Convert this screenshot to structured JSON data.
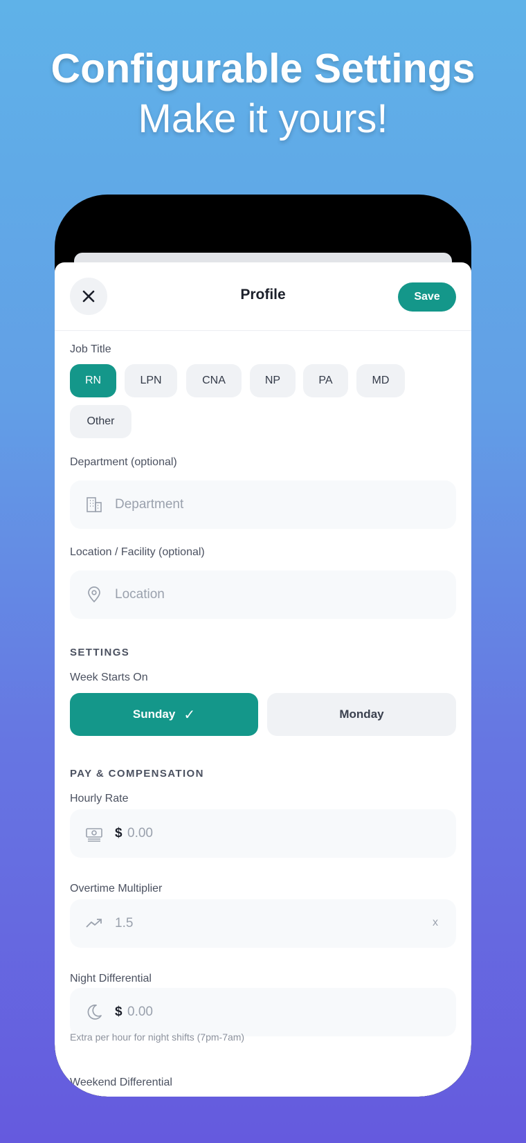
{
  "promo": {
    "headline": "Configurable Settings",
    "subheadline": "Make it yours!"
  },
  "header": {
    "title": "Profile",
    "save_label": "Save",
    "close_icon": "close-icon"
  },
  "job_title": {
    "label": "Job Title",
    "options": [
      "RN",
      "LPN",
      "CNA",
      "NP",
      "PA",
      "MD",
      "Other"
    ],
    "selected": "RN"
  },
  "department": {
    "label": "Department (optional)",
    "placeholder": "Department",
    "icon": "building-icon"
  },
  "location": {
    "label": "Location / Facility (optional)",
    "placeholder": "Location",
    "icon": "map-pin-icon"
  },
  "settings": {
    "section_title": "SETTINGS",
    "week_starts_label": "Week Starts On",
    "options": [
      "Sunday",
      "Monday"
    ],
    "selected": "Sunday",
    "check_mark": "✓"
  },
  "pay": {
    "section_title": "PAY & COMPENSATION",
    "hourly_rate": {
      "label": "Hourly Rate",
      "currency": "$",
      "placeholder": "0.00",
      "icon": "money-icon"
    },
    "overtime": {
      "label": "Overtime Multiplier",
      "placeholder": "1.5",
      "suffix": "x",
      "icon": "trending-up-icon"
    },
    "night_diff": {
      "label": "Night Differential",
      "currency": "$",
      "placeholder": "0.00",
      "icon": "moon-icon",
      "helper": "Extra per hour for night shifts (7pm-7am)"
    },
    "weekend_diff": {
      "label": "Weekend Differential"
    }
  },
  "colors": {
    "accent": "#14978a",
    "chip_bg": "#f0f2f5",
    "field_bg": "#f7f9fb"
  }
}
